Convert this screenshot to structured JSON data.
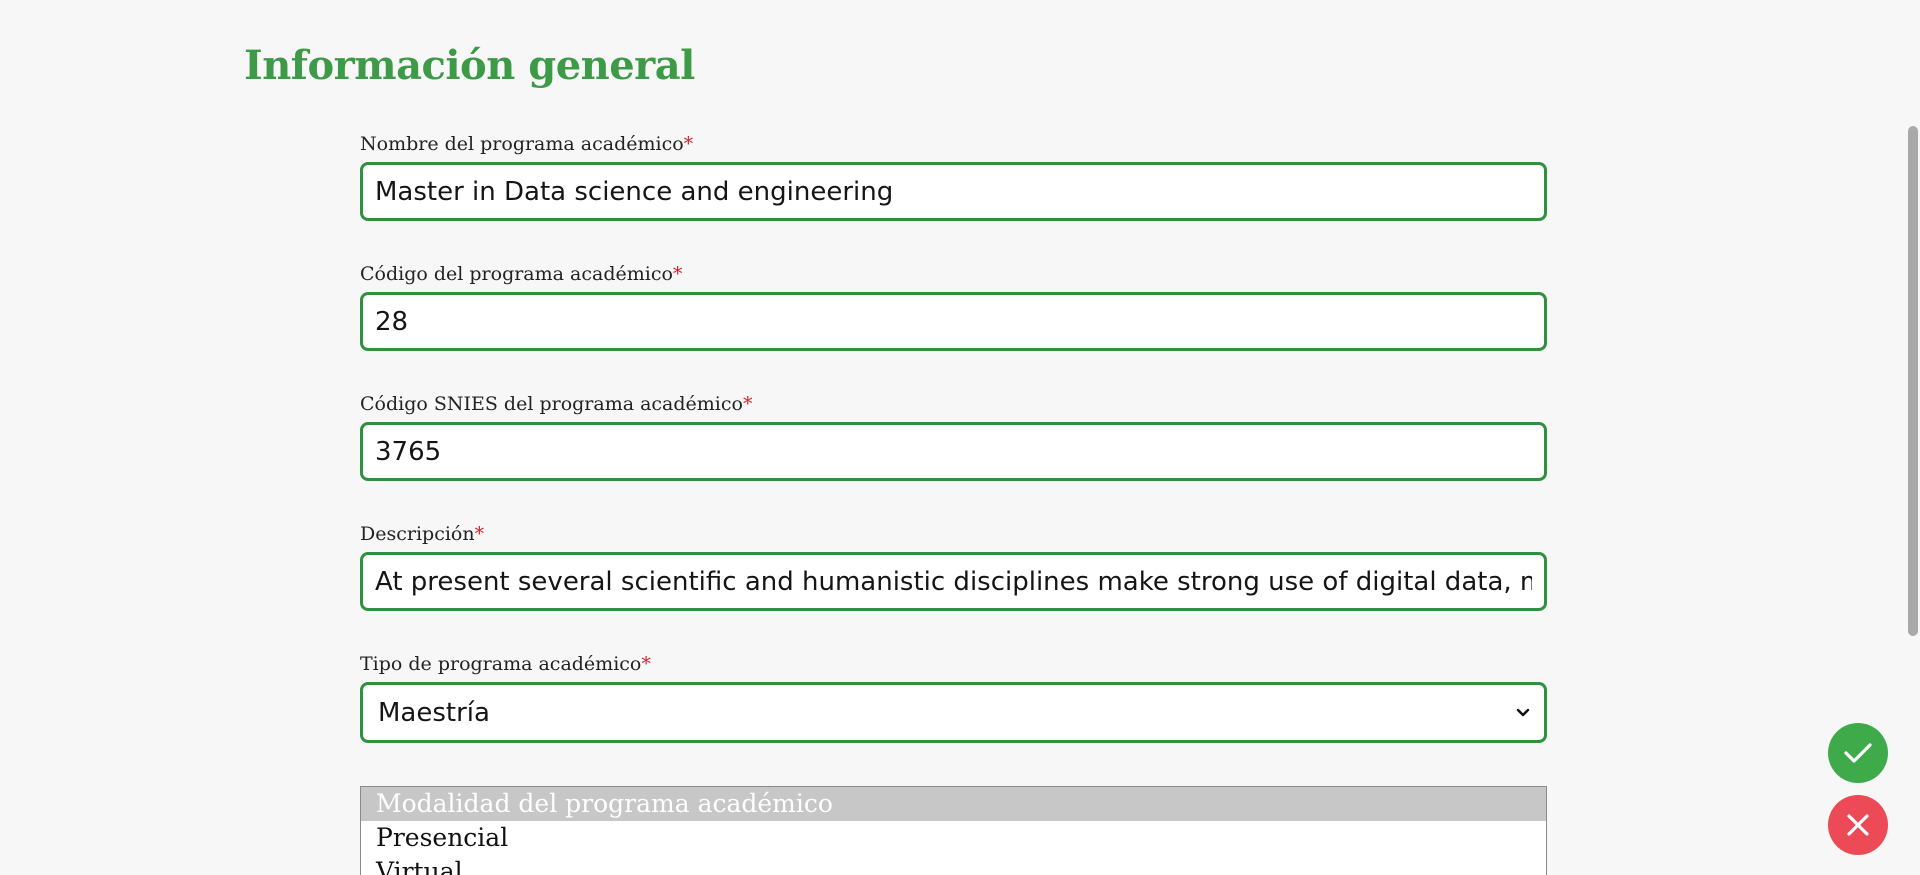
{
  "section": {
    "title": "Información general"
  },
  "form": {
    "required_marker": "*",
    "fields": [
      {
        "label": "Nombre del programa académico",
        "value": "Master in Data science and engineering"
      },
      {
        "label": "Código del programa académico",
        "value": "28"
      },
      {
        "label": "Código SNIES del programa académico",
        "value": "3765"
      },
      {
        "label": "Descripción",
        "value": "At present several scientific and humanistic disciplines make strong use of digital data, mainly in c"
      }
    ],
    "program_type": {
      "label": "Tipo de programa académico",
      "selected": "Maestría"
    },
    "modality": {
      "placeholder": "Modalidad del programa académico",
      "options": [
        "Presencial",
        "Virtual"
      ]
    }
  },
  "actions": {
    "confirm_icon": "check-icon",
    "cancel_icon": "close-icon"
  },
  "colors": {
    "title_green": "#3d9a47",
    "border_green": "#2f9040",
    "required_red": "#d2232a",
    "confirm_green": "#3faa4a",
    "cancel_red": "#ec4a57",
    "page_background": "#f7f7f7"
  }
}
